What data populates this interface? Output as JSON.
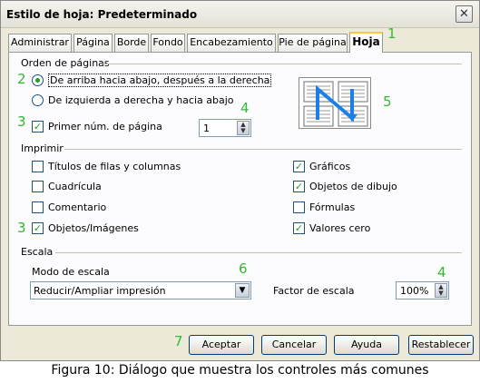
{
  "window": {
    "title": "Estilo de hoja: Predeterminado",
    "close_glyph": "✕"
  },
  "tabs": [
    {
      "label": "Administrar"
    },
    {
      "label": "Página"
    },
    {
      "label": "Borde"
    },
    {
      "label": "Fondo"
    },
    {
      "label": "Encabezamiento"
    },
    {
      "label": "Pie de página"
    },
    {
      "label": "Hoja",
      "active": true
    }
  ],
  "page_order": {
    "heading": "Orden de páginas",
    "option_top_down": "De arriba hacia abajo, después a la derecha",
    "option_left_right": "De izquierda a derecha y hacia abajo",
    "selected": "top_down",
    "first_page_label": "Primer núm. de página",
    "first_page_checked": true,
    "first_page_value": "1"
  },
  "print": {
    "heading": "Imprimir",
    "left": [
      {
        "label": "Títulos de filas y columnas",
        "checked": false
      },
      {
        "label": "Cuadrícula",
        "checked": false
      },
      {
        "label": "Comentario",
        "checked": false
      },
      {
        "label": "Objetos/Imágenes",
        "checked": true
      }
    ],
    "right": [
      {
        "label": "Gráficos",
        "checked": true
      },
      {
        "label": "Objetos de dibujo",
        "checked": true
      },
      {
        "label": "Fórmulas",
        "checked": false
      },
      {
        "label": "Valores cero",
        "checked": true
      }
    ]
  },
  "scale": {
    "heading": "Escala",
    "mode_label": "Modo de escala",
    "mode_value": "Reducir/Ampliar impresión",
    "factor_label": "Factor de escala",
    "factor_value": "100%"
  },
  "buttons": {
    "ok": "Aceptar",
    "cancel": "Cancelar",
    "help": "Ayuda",
    "reset": "Restablecer"
  },
  "annotations": {
    "n1": "1",
    "n2": "2",
    "n3a": "3",
    "n3b": "3",
    "n4a": "4",
    "n4b": "4",
    "n5": "5",
    "n6": "6",
    "n7": "7"
  },
  "caption": "Figura 10: Diálogo que muestra los controles más comunes",
  "colors": {
    "annotation": "#2fbb2f",
    "check": "#21a121",
    "preview_arrow": "#1a7fe6"
  }
}
